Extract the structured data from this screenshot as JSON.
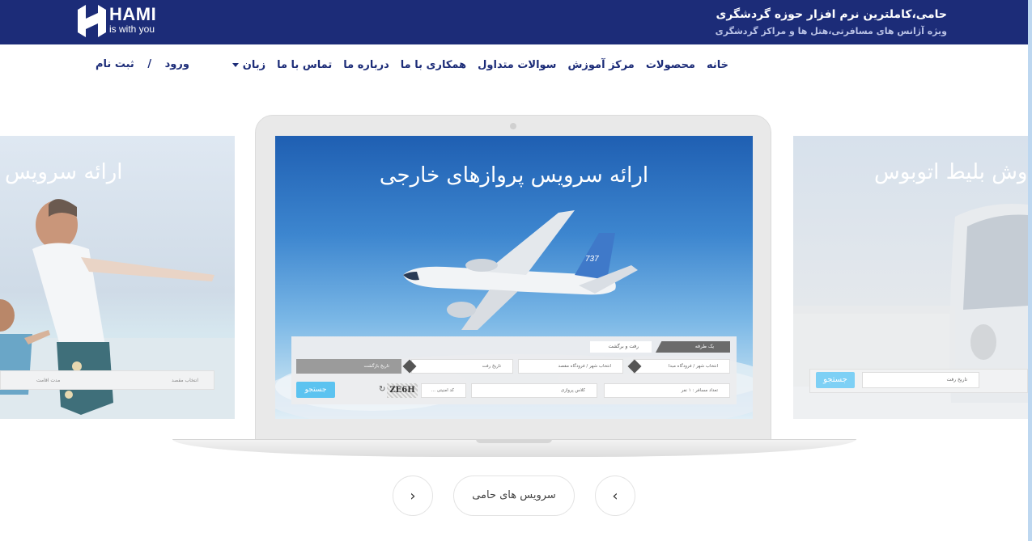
{
  "brand": {
    "name": "HAMI",
    "tagline": "is with you",
    "headline": "حامی،کاملترین نرم افزار حوزه گردشگری",
    "subline": "ویژه آژانس های مسافرتی،هتل ها و مراکز گردشگری"
  },
  "nav": {
    "items": [
      "خانه",
      "محصولات",
      "مرکز آموزش",
      "سوالات متداول",
      "همکاری با ما",
      "درباره ما",
      "تماس با ما",
      "زبان"
    ]
  },
  "auth": {
    "login": "ورود",
    "separator": "/",
    "register": "ثبت نام"
  },
  "slider": {
    "left_slide_title": "ارائه سرویس",
    "center_slide_title": "ارائه سرویس پروازهای خارجی",
    "right_slide_title": "وش بلیط اتوبوس",
    "left_form": {
      "destination": "انتخاب مقصد",
      "stay": "مدت اقامت"
    },
    "right_form": {
      "date": "تاریخ رفت",
      "search": "جستجو"
    },
    "search_panel": {
      "tab_oneway": "یک طرفه",
      "tab_roundtrip": "رفت و برگشت",
      "origin": "انتخاب شهر / فرودگاه مبدا",
      "destination": "انتخاب شهر / فرودگاه مقصد",
      "depart_date": "تاریخ رفت",
      "return_date": "تاریخ بازگشت",
      "passengers": "تعداد مسافر : ۱ نفر",
      "class": "کلاس پروازی",
      "captcha_placeholder": "کد امنیتی ...",
      "captcha_text": "ZE6H",
      "search": "جستجو"
    }
  },
  "carousel": {
    "label": "سرویس های حامی",
    "prev": "‹",
    "next": "›"
  },
  "colors": {
    "primary": "#1c2c78",
    "accent": "#5cc3f0"
  }
}
